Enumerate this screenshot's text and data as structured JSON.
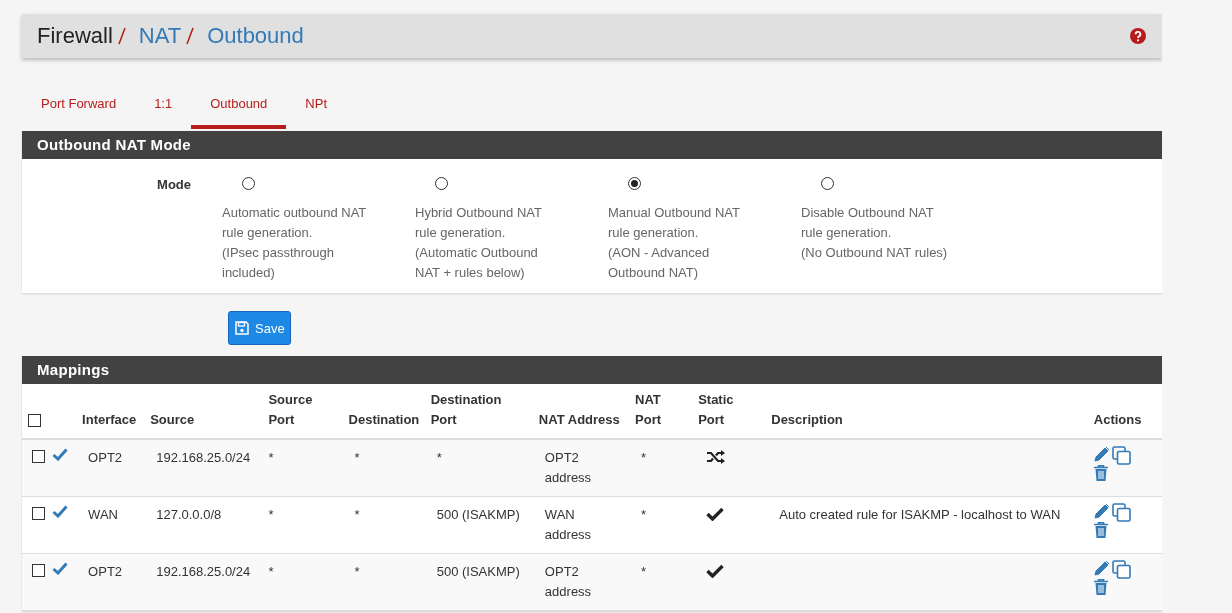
{
  "breadcrumb": [
    {
      "label": "Firewall",
      "link": false
    },
    {
      "label": "NAT",
      "link": true
    },
    {
      "label": "Outbound",
      "link": true
    }
  ],
  "tabs": [
    {
      "label": "Port Forward",
      "selected": false
    },
    {
      "label": "1:1",
      "selected": false
    },
    {
      "label": "Outbound",
      "selected": true
    },
    {
      "label": "NPt",
      "selected": false
    }
  ],
  "mode_panel": {
    "title": "Outbound NAT Mode",
    "label": "Mode",
    "options": [
      {
        "lines": [
          "Automatic outbound NAT",
          "rule generation.",
          "(IPsec passthrough",
          "included)"
        ],
        "selected": false
      },
      {
        "lines": [
          "Hybrid Outbound NAT",
          "rule generation.",
          "(Automatic Outbound",
          "NAT + rules below)"
        ],
        "selected": false
      },
      {
        "lines": [
          "Manual Outbound NAT",
          "rule generation.",
          "(AON - Advanced",
          "Outbound NAT)"
        ],
        "selected": true
      },
      {
        "lines": [
          "Disable Outbound NAT",
          "rule generation.",
          "(No Outbound NAT rules)"
        ],
        "selected": false
      }
    ]
  },
  "save_button": "Save",
  "mappings": {
    "title": "Mappings",
    "select_all_checked": false,
    "columns": [
      [
        "Interface"
      ],
      [
        "Source"
      ],
      [
        "Source",
        "Port"
      ],
      [
        "Destination"
      ],
      [
        "Destination",
        "Port"
      ],
      [
        "NAT Address"
      ],
      [
        "NAT",
        "Port"
      ],
      [
        "Static",
        "Port"
      ],
      [
        "Description"
      ],
      [
        "Actions"
      ]
    ],
    "rows": [
      {
        "checked": false,
        "enabled": true,
        "interface": "OPT2",
        "source": "192.168.25.0/24",
        "source_port": "*",
        "destination": "*",
        "destination_port": "*",
        "nat_address": [
          "OPT2",
          "address"
        ],
        "nat_port": "*",
        "static_port": false,
        "description": ""
      },
      {
        "checked": false,
        "enabled": true,
        "interface": "WAN",
        "source": "127.0.0.0/8",
        "source_port": "*",
        "destination": "*",
        "destination_port": "500 (ISAKMP)",
        "nat_address": [
          "WAN",
          "address"
        ],
        "nat_port": "*",
        "static_port": true,
        "description": "Auto created rule for ISAKMP - localhost to WAN"
      },
      {
        "checked": false,
        "enabled": true,
        "interface": "OPT2",
        "source": "192.168.25.0/24",
        "source_port": "*",
        "destination": "*",
        "destination_port": "500 (ISAKMP)",
        "nat_address": [
          "OPT2",
          "address"
        ],
        "nat_port": "*",
        "static_port": true,
        "description": ""
      }
    ]
  }
}
